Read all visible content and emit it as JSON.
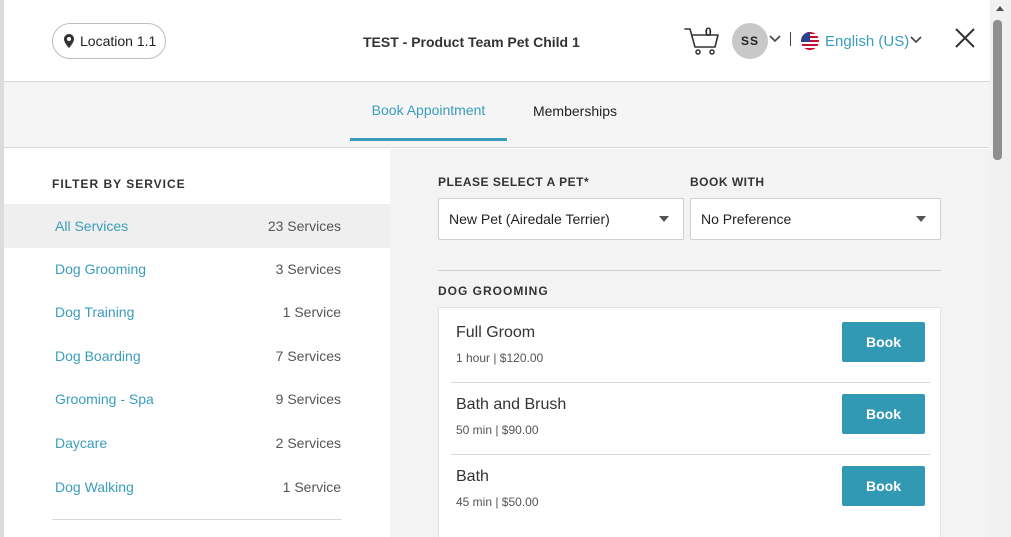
{
  "header": {
    "location_label": "Location 1.1",
    "title": "TEST - Product Team Pet Child 1",
    "cart_count": "0",
    "avatar_initials": "SS",
    "language": "English (US)"
  },
  "tabs": [
    {
      "label": "Book Appointment",
      "active": true
    },
    {
      "label": "Memberships",
      "active": false
    }
  ],
  "sidebar": {
    "heading": "FILTER BY SERVICE",
    "items": [
      {
        "name": "All Services",
        "count": "23 Services",
        "active": true
      },
      {
        "name": "Dog Grooming",
        "count": "3 Services"
      },
      {
        "name": "Dog Training",
        "count": "1 Service"
      },
      {
        "name": "Dog Boarding",
        "count": "7 Services"
      },
      {
        "name": "Grooming - Spa",
        "count": "9 Services"
      },
      {
        "name": "Daycare",
        "count": "2 Services"
      },
      {
        "name": "Dog Walking",
        "count": "1 Service"
      }
    ]
  },
  "main": {
    "pet_label": "PLEASE SELECT A PET*",
    "pet_value": "New Pet (Airedale Terrier)",
    "book_with_label": "BOOK WITH",
    "book_with_value": "No Preference",
    "section_heading": "DOG GROOMING",
    "services": [
      {
        "name": "Full Groom",
        "meta": "1 hour | $120.00",
        "button": "Book"
      },
      {
        "name": "Bath and Brush",
        "meta": "50 min | $90.00",
        "button": "Book"
      },
      {
        "name": "Bath",
        "meta": "45 min | $50.00",
        "button": "Book"
      }
    ]
  },
  "colors": {
    "accent": "#3a9dbb",
    "button": "#3199b3"
  }
}
